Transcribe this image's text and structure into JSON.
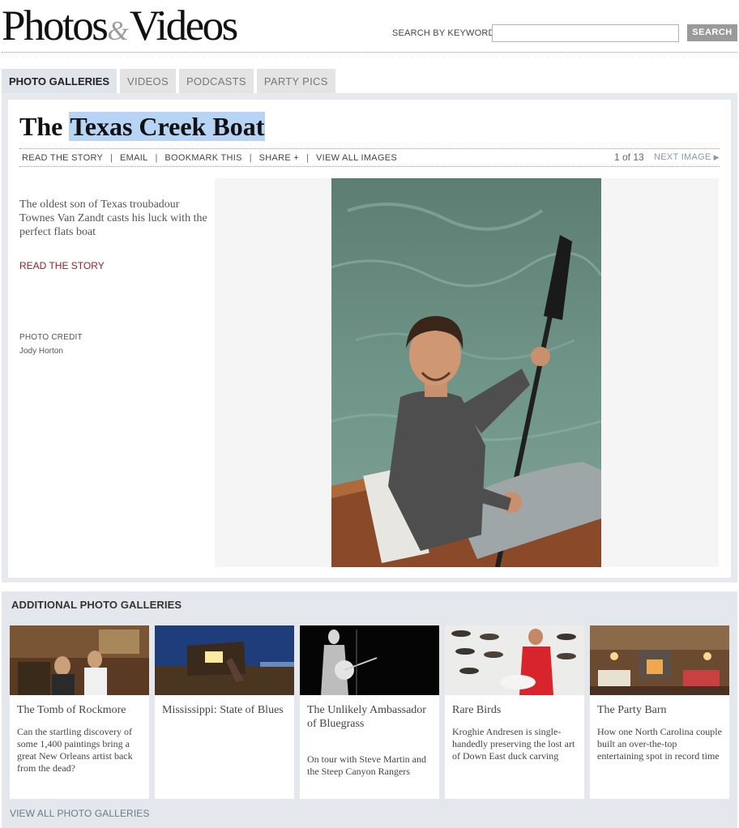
{
  "header": {
    "logo_part1": "Photos",
    "logo_amp": "&",
    "logo_part2": "Videos",
    "search_label": "SEARCH BY KEYWORD",
    "search_value": "",
    "search_button": "SEARCH"
  },
  "tabs": [
    {
      "label": "PHOTO GALLERIES",
      "active": true
    },
    {
      "label": "VIDEOS",
      "active": false
    },
    {
      "label": "PODCASTS",
      "active": false
    },
    {
      "label": "PARTY PICS",
      "active": false
    }
  ],
  "gallery": {
    "title_prefix": "The ",
    "title_highlight": "Texas Creek Boat",
    "nav": [
      "READ THE STORY",
      "EMAIL",
      "BOOKMARK THIS",
      "SHARE +",
      "VIEW ALL IMAGES"
    ],
    "counter": "1 of 13",
    "next_label": "NEXT IMAGE",
    "next_arrow": "▶",
    "description": "The oldest son of Texas troubadour Townes Van Zandt casts his luck with the perfect flats boat",
    "read_story": "READ THE STORY",
    "credit_label": "PHOTO CREDIT",
    "credit_name": "Jody Horton"
  },
  "additional": {
    "title": "ADDITIONAL PHOTO GALLERIES",
    "cards": [
      {
        "title": "The Tomb of Rockmore",
        "desc": "Can the startling discovery of some 1,400 paintings bring a great New Orleans artist back from the dead?"
      },
      {
        "title": "Mississippi: State of Blues",
        "desc": ""
      },
      {
        "title": "The Unlikely Ambassador of Bluegrass",
        "desc": "On tour with Steve Martin and the Steep Canyon Rangers"
      },
      {
        "title": "Rare Birds",
        "desc": "Kroghie Andresen is single-handedly preserving the lost art of Down East duck carving"
      },
      {
        "title": "The Party Barn",
        "desc": "How one North Carolina couple built an over-the-top entertaining spot in record time"
      }
    ],
    "view_all": "VIEW ALL PHOTO GALLERIES"
  },
  "colors": {
    "accent_red": "#9b1b1b",
    "highlight": "#b8d4f5",
    "tab_active_bg": "#dfe5ea",
    "tab_bg": "#e4e4e4",
    "search_button_bg": "#9a9a9a"
  }
}
